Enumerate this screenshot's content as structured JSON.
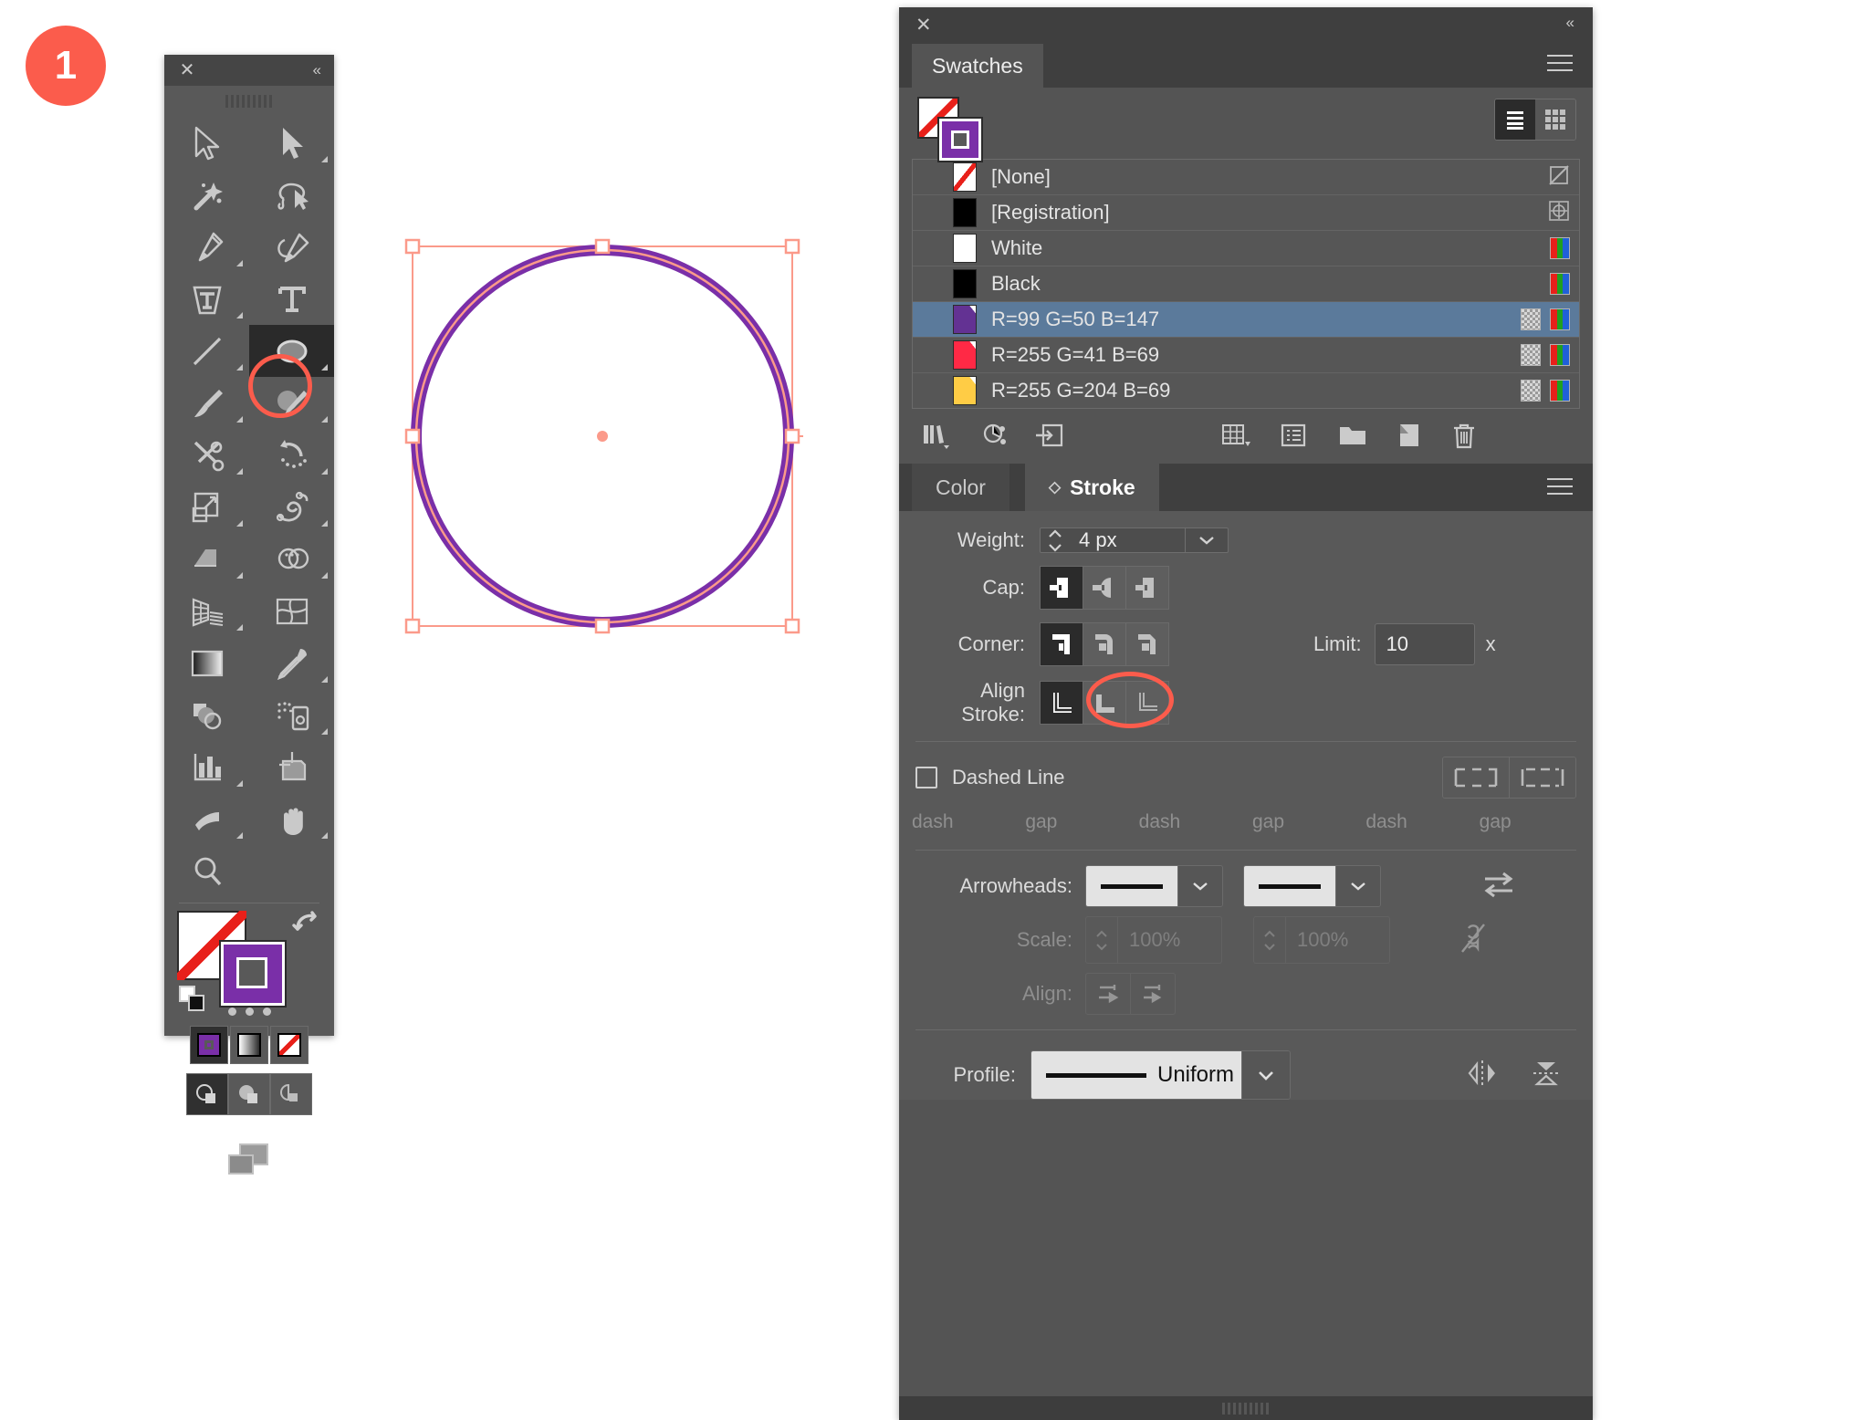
{
  "step": {
    "number": "1"
  },
  "toolbar": {
    "close_label": "✕",
    "collapse_label": "«",
    "tools": [
      {
        "name": "selection-tool",
        "icon": "arrow-solid-outline",
        "corner": false
      },
      {
        "name": "direct-selection-tool",
        "icon": "arrow-filled",
        "corner": true
      },
      {
        "name": "magic-wand-tool",
        "icon": "magic-wand",
        "corner": false
      },
      {
        "name": "lasso-tool",
        "icon": "lasso",
        "corner": false
      },
      {
        "name": "pen-tool",
        "icon": "pen",
        "corner": true
      },
      {
        "name": "curvature-tool",
        "icon": "curvature-pen",
        "corner": false
      },
      {
        "name": "type-tool",
        "icon": "type-warp",
        "corner": true
      },
      {
        "name": "type-tool-alt",
        "icon": "type-serif",
        "corner": false
      },
      {
        "name": "line-segment-tool",
        "icon": "line-diagonal",
        "corner": true
      },
      {
        "name": "ellipse-tool",
        "icon": "ellipse",
        "corner": true,
        "selected": true
      },
      {
        "name": "paintbrush-tool",
        "icon": "paintbrush",
        "corner": true
      },
      {
        "name": "shaper-tool",
        "icon": "shaper-pencil",
        "corner": true
      },
      {
        "name": "scissors-tool",
        "icon": "scissors",
        "corner": true
      },
      {
        "name": "rotate-tool",
        "icon": "rotate",
        "corner": true
      },
      {
        "name": "scale-tool",
        "icon": "scale",
        "corner": true
      },
      {
        "name": "width-tool",
        "icon": "warp-twirl",
        "corner": true
      },
      {
        "name": "free-transform-tool",
        "icon": "free-transform",
        "corner": true
      },
      {
        "name": "shape-builder-tool",
        "icon": "shape-builder",
        "corner": true
      },
      {
        "name": "perspective-grid-tool",
        "icon": "perspective-grid",
        "corner": true
      },
      {
        "name": "mesh-tool",
        "icon": "mesh",
        "corner": false
      },
      {
        "name": "gradient-tool",
        "icon": "gradient",
        "corner": false
      },
      {
        "name": "eyedropper-tool",
        "icon": "eyedropper",
        "corner": true
      },
      {
        "name": "blend-tool",
        "icon": "blend",
        "corner": false
      },
      {
        "name": "symbol-sprayer-tool",
        "icon": "symbol-sprayer",
        "corner": true
      },
      {
        "name": "column-graph-tool",
        "icon": "bar-graph",
        "corner": true
      },
      {
        "name": "artboard-tool",
        "icon": "artboard",
        "corner": false
      },
      {
        "name": "slice-tool",
        "icon": "slice-knife",
        "corner": true
      },
      {
        "name": "hand-tool",
        "icon": "hand",
        "corner": true
      },
      {
        "name": "zoom-tool",
        "icon": "magnifier",
        "corner": false
      }
    ],
    "fill_color": "#ffffff",
    "fill_is_none": true,
    "stroke_color": "#7a2fa8",
    "paint_modes": [
      {
        "name": "color-mode-button",
        "label": "color",
        "selected": true
      },
      {
        "name": "gradient-mode-button",
        "label": "gradient",
        "selected": false
      },
      {
        "name": "none-mode-button",
        "label": "none",
        "selected": false
      }
    ],
    "draw_modes": [
      {
        "name": "draw-normal-button",
        "selected": true
      },
      {
        "name": "draw-behind-button",
        "selected": false
      },
      {
        "name": "draw-inside-button",
        "selected": false
      }
    ],
    "more_tools_label": "•••"
  },
  "dock": {
    "close_label": "✕",
    "collapse_label": "«"
  },
  "swatches": {
    "tab_label": "Swatches",
    "view_list_label": "List View",
    "view_grid_label": "Grid View",
    "active_view": "list",
    "fill_color": "#ffffff",
    "stroke_color": "#7a2fa8",
    "rows": [
      {
        "label": "[None]",
        "color": "#ffffff",
        "none": true,
        "global": false,
        "rgb": false,
        "right_icon": "none-swatch-icon",
        "selected": false
      },
      {
        "label": "[Registration]",
        "color": "#000000",
        "none": false,
        "global": false,
        "rgb": false,
        "right_icon": "registration-icon",
        "selected": false
      },
      {
        "label": "White",
        "color": "#ffffff",
        "none": false,
        "global": false,
        "rgb": true,
        "right_icon": "rgb-icon",
        "selected": false
      },
      {
        "label": "Black",
        "color": "#000000",
        "none": false,
        "global": false,
        "rgb": true,
        "right_icon": "rgb-icon",
        "selected": false
      },
      {
        "label": "R=99 G=50 B=147",
        "color": "#633293",
        "none": false,
        "global": true,
        "rgb": true,
        "right_icon": "rgb-icon",
        "selected": true
      },
      {
        "label": "R=255 G=41 B=69",
        "color": "#ff2945",
        "none": false,
        "global": true,
        "rgb": true,
        "right_icon": "rgb-icon",
        "selected": false
      },
      {
        "label": "R=255 G=204 B=69",
        "color": "#ffcc45",
        "none": false,
        "global": true,
        "rgb": true,
        "right_icon": "rgb-icon",
        "selected": false
      }
    ],
    "footer_buttons": [
      {
        "name": "swatch-libraries-menu-button"
      },
      {
        "name": "show-color-group-button"
      },
      {
        "name": "add-to-library-button"
      },
      {
        "name": "swatch-options-kinds-button"
      },
      {
        "name": "swatch-options-button"
      },
      {
        "name": "new-color-group-button"
      },
      {
        "name": "new-swatch-button"
      },
      {
        "name": "delete-swatch-button"
      }
    ]
  },
  "stroke_panel": {
    "tabs": [
      {
        "label": "Color",
        "name": "tab-color",
        "active": false
      },
      {
        "label": "Stroke",
        "name": "tab-stroke",
        "active": true
      }
    ],
    "weight_label": "Weight:",
    "weight_value": "4 px",
    "cap_label": "Cap:",
    "cap_options": [
      {
        "name": "butt-cap-button",
        "selected": true
      },
      {
        "name": "round-cap-button",
        "selected": false
      },
      {
        "name": "projecting-cap-button",
        "selected": false
      }
    ],
    "corner_label": "Corner:",
    "corner_options": [
      {
        "name": "miter-join-button",
        "selected": true
      },
      {
        "name": "round-join-button",
        "selected": false
      },
      {
        "name": "bevel-join-button",
        "selected": false
      }
    ],
    "limit_label": "Limit:",
    "limit_value": "10",
    "limit_unit": "x",
    "align_stroke_label": "Align Stroke:",
    "align_stroke_options": [
      {
        "name": "align-stroke-center-button",
        "selected": true
      },
      {
        "name": "align-stroke-inside-button",
        "selected": false
      },
      {
        "name": "align-stroke-outside-button",
        "selected": false
      }
    ],
    "dashed_line_label": "Dashed Line",
    "dashed_line_checked": false,
    "dash_buttons": [
      {
        "name": "preserve-exact-dash-button"
      },
      {
        "name": "align-dashes-corners-button"
      }
    ],
    "dash_fields": [
      {
        "caption": "dash",
        "value": ""
      },
      {
        "caption": "gap",
        "value": ""
      },
      {
        "caption": "dash",
        "value": ""
      },
      {
        "caption": "gap",
        "value": ""
      },
      {
        "caption": "dash",
        "value": ""
      },
      {
        "caption": "gap",
        "value": ""
      }
    ],
    "arrowheads_label": "Arrowheads:",
    "arrowhead_start": "",
    "arrowhead_end": "",
    "swap_arrowheads_name": "swap-arrowheads-button",
    "scale_label": "Scale:",
    "scale_start": "100%",
    "scale_end": "100%",
    "link_scales_name": "link-arrowhead-scales-button",
    "align_label": "Align:",
    "align_options": [
      {
        "name": "extend-arrow-beyond-end-button"
      },
      {
        "name": "place-arrow-at-end-button"
      }
    ],
    "profile_label": "Profile:",
    "profile_value": "Uniform",
    "flip_across_name": "flip-across-button",
    "flip_along_name": "flip-along-button"
  },
  "artwork": {
    "shape": "ellipse",
    "stroke_color": "#7a2fa8",
    "stroke_width_px": "4 px",
    "fill": "none",
    "selection_color": "#fb8f7d",
    "handles": 8
  },
  "colors": {
    "accent": "#fb5c4c",
    "purple": "#7a2fa8",
    "selection_blue": "#5b7a9b",
    "panel_bg": "#545454",
    "panel_dark": "#3f3f3f"
  }
}
